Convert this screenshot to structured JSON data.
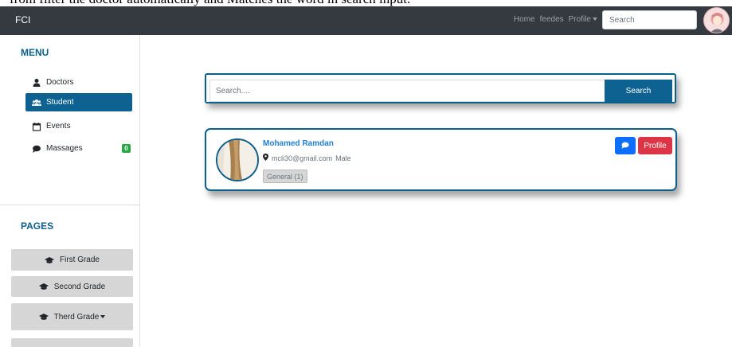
{
  "caption": {
    "text": "from filter the doctor automatically and Matches the word in search input."
  },
  "navbar": {
    "brand": "FCI",
    "links": [
      "Home",
      "feedes",
      "Profile"
    ],
    "search_placeholder": "Search"
  },
  "sidebar": {
    "menu_title": "MENU",
    "items": [
      {
        "label": "Doctors",
        "icon": "user-icon"
      },
      {
        "label": "Student",
        "icon": "users-icon",
        "active": true
      },
      {
        "label": "Events",
        "icon": "calendar-icon"
      },
      {
        "label": "Massages",
        "icon": "comment-icon",
        "badge": "0"
      }
    ],
    "pages_title": "PAGES",
    "grades": [
      "First Grade",
      "Second Grade",
      "Therd Grade"
    ]
  },
  "search": {
    "placeholder": "Search....",
    "button": "Search"
  },
  "profile_card": {
    "name": "Mohamed Ramdan",
    "email": "mcli30@gmail.com",
    "gender": "Male",
    "tag": "General (1)",
    "profile_button": "Profile"
  },
  "colors": {
    "navbar": "#343a40",
    "primary": "#0d6291",
    "accent_text": "#0d5f8c",
    "danger": "#dc3545",
    "message_button": "#0d6efd",
    "badge": "#28a745"
  }
}
